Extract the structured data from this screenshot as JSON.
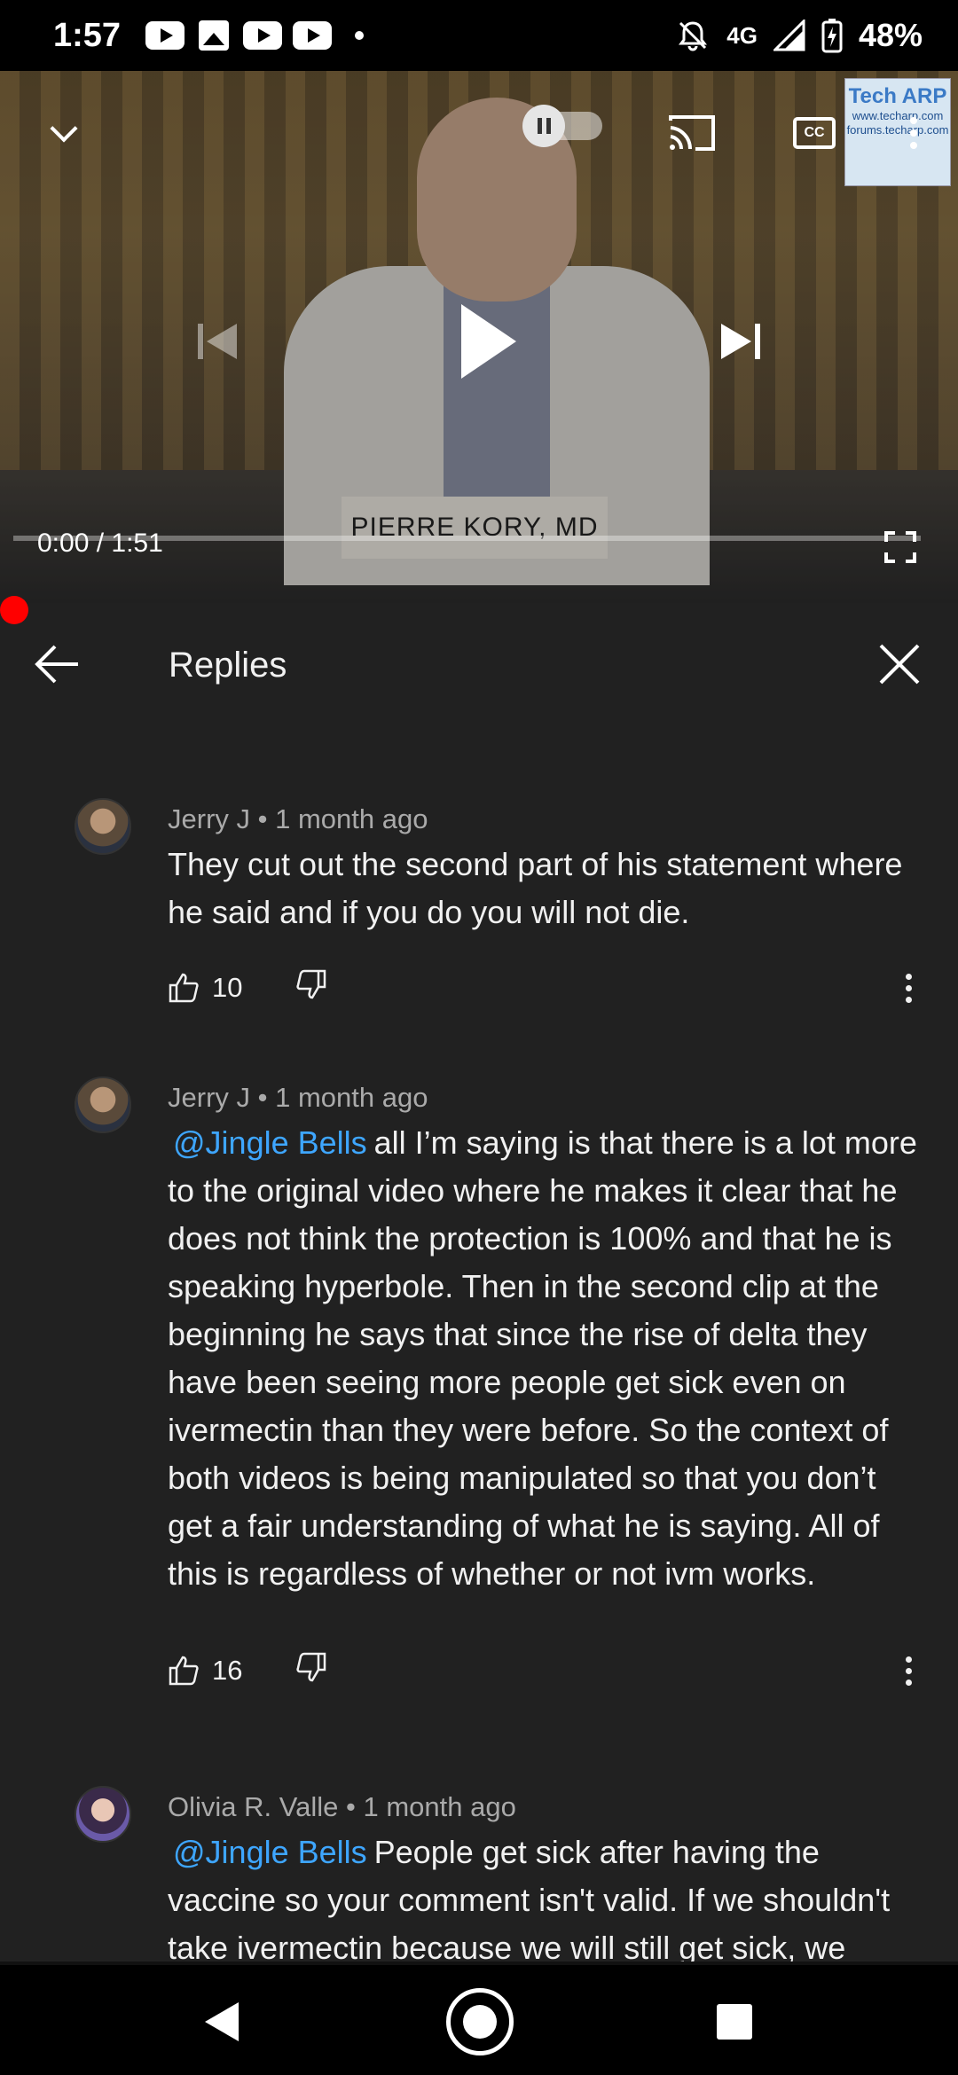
{
  "status_bar": {
    "time": "1:57",
    "network": "4G",
    "battery": "48%",
    "icons": [
      "youtube-icon",
      "gallery-icon",
      "youtube-icon",
      "youtube-icon",
      "dot-icon",
      "bell-off-icon",
      "signal-icon",
      "battery-charging-icon"
    ]
  },
  "video": {
    "nameplate": "PIERRE KORY, MD",
    "watermark_title": "Tech ARP",
    "watermark_line1": "www.techarp.com",
    "watermark_line2": "forums.techarp.com",
    "current_time": "0:00",
    "duration": "1:51",
    "time_separator": " / ",
    "progress": 0,
    "cc_label": "CC"
  },
  "replies": {
    "title": "Replies"
  },
  "comments": [
    {
      "author": "Jerry J",
      "age": "1 month ago",
      "mention": "",
      "text": "They cut out the second part of his statement where he said and if you do you will not die.",
      "likes": "10"
    },
    {
      "author": "Jerry J",
      "age": "1 month ago",
      "mention": "@Jingle Bells",
      "text": "all I’m saying is that there is a lot more to the original video where he makes it clear that he does not think the protection is 100% and that he is speaking hyperbole.  Then in the second clip at the beginning he says that since the rise of delta they have been seeing more people get sick even on ivermectin than they were before.  So the context of both videos is being manipulated so that you don’t get a fair understanding of what he is saying.  All of this is regardless of whether or not ivm works.",
      "likes": "16"
    },
    {
      "author": "Olivia R. Valle",
      "age": "1 month ago",
      "mention": "@Jingle Bells",
      "text": "People get sick after having the vaccine so your comment isn't valid. If we shouldn't take ivermectin because we will still get sick, we",
      "likes": ""
    }
  ],
  "meta_separator": " • ",
  "colors": {
    "background": "#212121",
    "mention": "#3ea6ff",
    "progress": "#ff0000",
    "meta": "#aaaaaa"
  }
}
